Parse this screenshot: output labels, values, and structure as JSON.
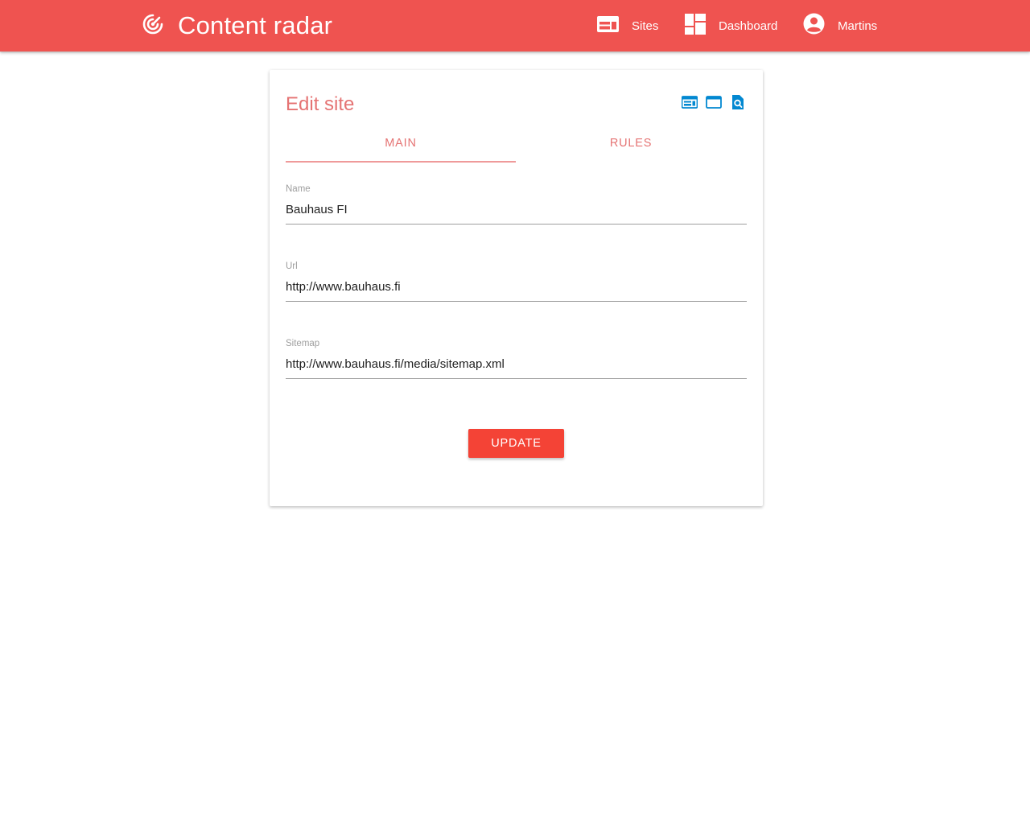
{
  "app": {
    "title": "Content radar",
    "logo_icon": "radar-icon"
  },
  "nav": {
    "sites": {
      "label": "Sites",
      "icon": "web-icon"
    },
    "dashboard": {
      "label": "Dashboard",
      "icon": "dashboard-icon"
    },
    "user": {
      "label": "Martins",
      "icon": "account-circle-icon"
    }
  },
  "card": {
    "title": "Edit site",
    "actions": [
      "web-icon",
      "browser-window-icon",
      "find-in-page-icon"
    ],
    "tabs": [
      {
        "label": "MAIN",
        "active": true
      },
      {
        "label": "RULES",
        "active": false
      }
    ],
    "fields": {
      "name": {
        "label": "Name",
        "value": "Bauhaus FI"
      },
      "url": {
        "label": "Url",
        "value": "http://www.bauhaus.fi"
      },
      "sitemap": {
        "label": "Sitemap",
        "value": "http://www.bauhaus.fi/media/sitemap.xml"
      }
    },
    "update_label": "UPDATE"
  },
  "colors": {
    "primary": "#ef5350",
    "accent": "#f44336",
    "title_text": "#e57373",
    "icon_blue": "#0288d1"
  }
}
